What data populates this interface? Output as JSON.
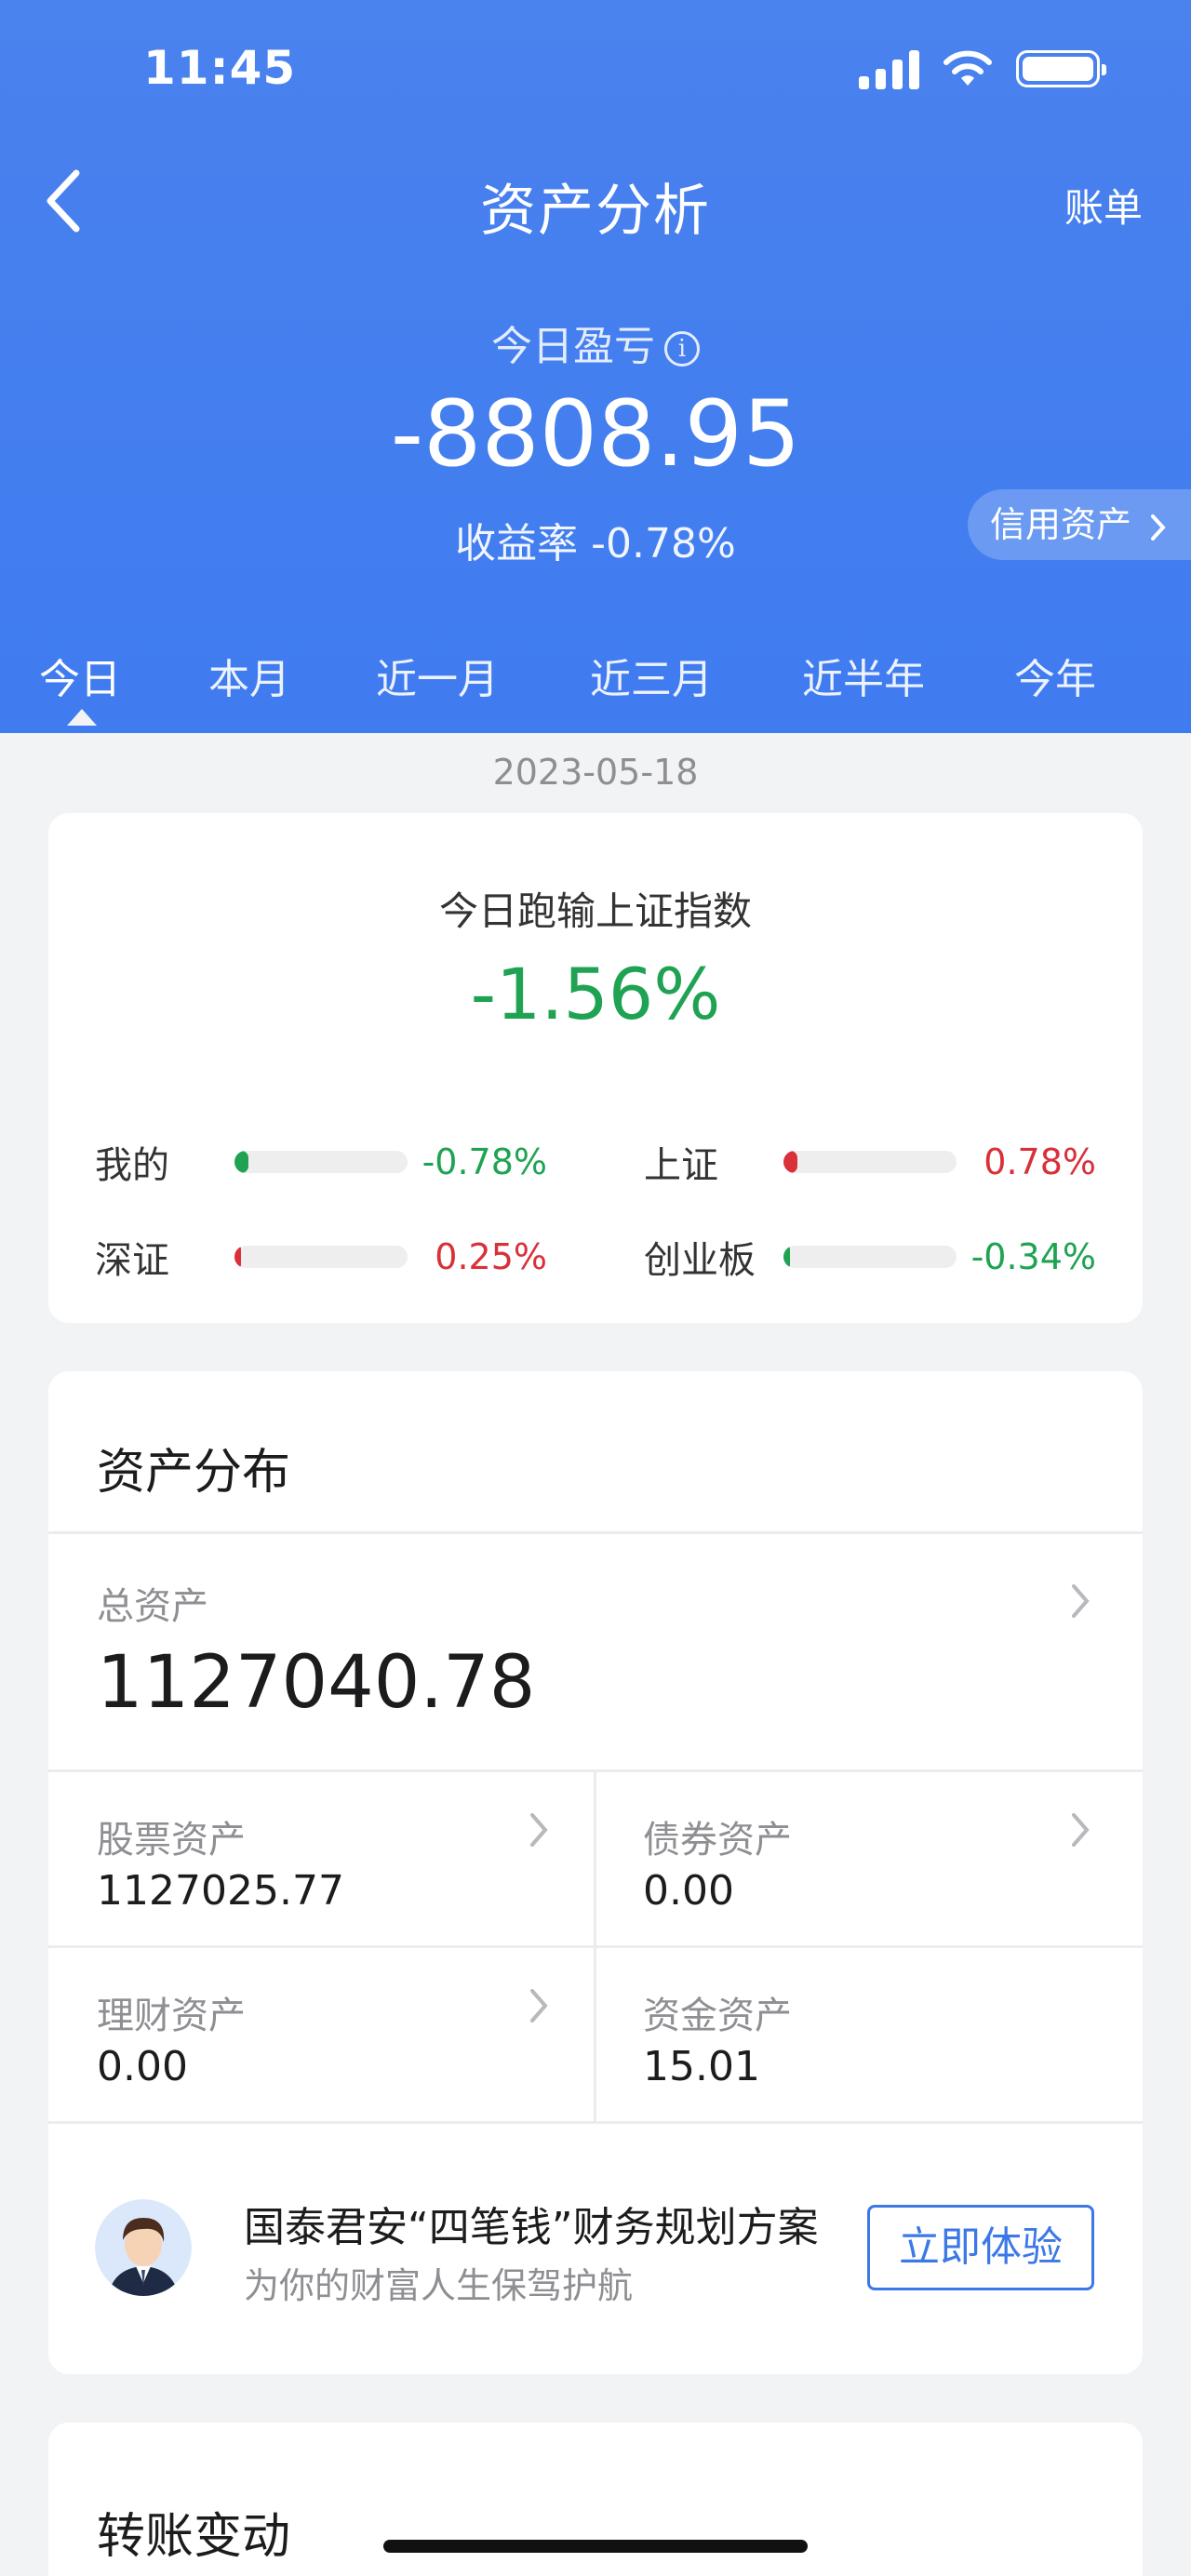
{
  "status_bar": {
    "time": "11:45"
  },
  "nav": {
    "title": "资产分析",
    "right_action": "账单"
  },
  "summary": {
    "pl_label": "今日盈亏",
    "pl_value": "-8808.95",
    "rate_text": "收益率 -0.78%",
    "credit_assets": "信用资产"
  },
  "tabs": [
    "今日",
    "本月",
    "近一月",
    "近三月",
    "近半年",
    "今年"
  ],
  "active_tab": "今日",
  "date": "2023-05-18",
  "comparison": {
    "title": "今日跑输上证指数",
    "value": "-1.56%",
    "items": [
      {
        "label": "我的",
        "value": "-0.78%",
        "fill": 0.08,
        "color": "#1fa353"
      },
      {
        "label": "上证",
        "value": "0.78%",
        "fill": 0.08,
        "color": "#d9303a"
      },
      {
        "label": "深证",
        "value": "0.25%",
        "fill": 0.03,
        "color": "#d9303a"
      },
      {
        "label": "创业板",
        "value": "-0.34%",
        "fill": 0.04,
        "color": "#1fa353"
      }
    ]
  },
  "assets": {
    "title": "资产分布",
    "total_label": "总资产",
    "total_value": "1127040.78",
    "stock_label": "股票资产",
    "stock_value": "1127025.77",
    "bond_label": "债券资产",
    "bond_value": "0.00",
    "wealth_label": "理财资产",
    "wealth_value": "0.00",
    "fund_label": "资金资产",
    "fund_value": "15.01"
  },
  "promo": {
    "title": "国泰君安“四笔钱”财务规划方案",
    "subtitle": "为你的财富人生保驾护航",
    "button": "立即体验"
  },
  "transfer": {
    "title": "转账变动"
  }
}
